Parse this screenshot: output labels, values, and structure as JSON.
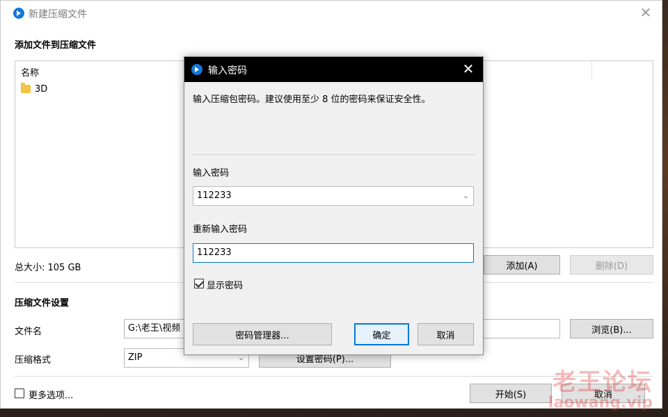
{
  "window": {
    "title": "新建压缩文件",
    "close_glyph": "✕"
  },
  "files_section": {
    "title": "添加文件到压缩文件",
    "column_name": "名称",
    "items": [
      {
        "name": "3D",
        "icon": "folder-icon"
      }
    ],
    "total_size": "总大小: 105 GB",
    "add_button": "添加(A)",
    "delete_button": "删除(D)"
  },
  "settings_section": {
    "title": "压缩文件设置",
    "filename_label": "文件名",
    "filename_value": "G:\\老王\\视频",
    "browse_button": "浏览(B)...",
    "format_label": "压缩格式",
    "format_value": "ZIP",
    "set_password_button": "设置密码(P)...",
    "more_options_label": "更多选项...",
    "start_button": "开始(S)",
    "cancel_button": "取消"
  },
  "dialog": {
    "title": "输入密码",
    "close_glyph": "✕",
    "description": "输入压缩包密码。建议使用至少 8 位的密码来保证安全性。",
    "password_label": "输入密码",
    "password_value": "112233",
    "confirm_label": "重新输入密码",
    "confirm_value": "112233",
    "show_password_label": "显示密码",
    "show_password_checked": true,
    "manager_button": "密码管理器...",
    "ok_button": "确定",
    "cancel_button": "取消"
  },
  "watermark": {
    "main": "老王论坛",
    "sub": "laowang.vip"
  },
  "colors": {
    "accent": "#0078d7",
    "app_icon": "#1677d9",
    "watermark": "#e23b3b"
  }
}
